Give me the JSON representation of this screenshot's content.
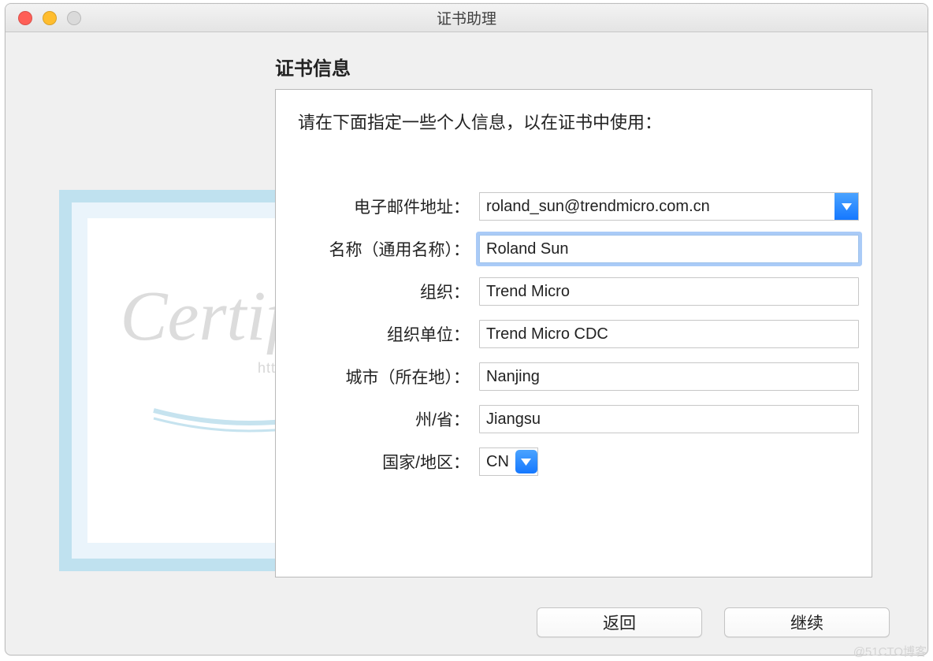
{
  "window": {
    "title": "证书助理"
  },
  "section": {
    "title": "证书信息",
    "instruction": "请在下面指定一些个人信息，以在证书中使用："
  },
  "form": {
    "email": {
      "label": "电子邮件地址：",
      "value": "roland_sun@trendmicro.com.cn"
    },
    "name": {
      "label": "名称（通用名称）：",
      "value": "Roland Sun"
    },
    "org": {
      "label": "组织：",
      "value": "Trend Micro"
    },
    "orgunit": {
      "label": "组织单位：",
      "value": "Trend Micro CDC"
    },
    "city": {
      "label": "城市（所在地）：",
      "value": "Nanjing"
    },
    "province": {
      "label": "州/省：",
      "value": "Jiangsu"
    },
    "country": {
      "label": "国家/地区：",
      "value": "CN"
    }
  },
  "buttons": {
    "back": "返回",
    "continue": "继续"
  },
  "decor": {
    "certificate_word": "Certificate",
    "blog_url": "http://blog.csdn.net/",
    "source_watermark": "@51CTO博客"
  }
}
